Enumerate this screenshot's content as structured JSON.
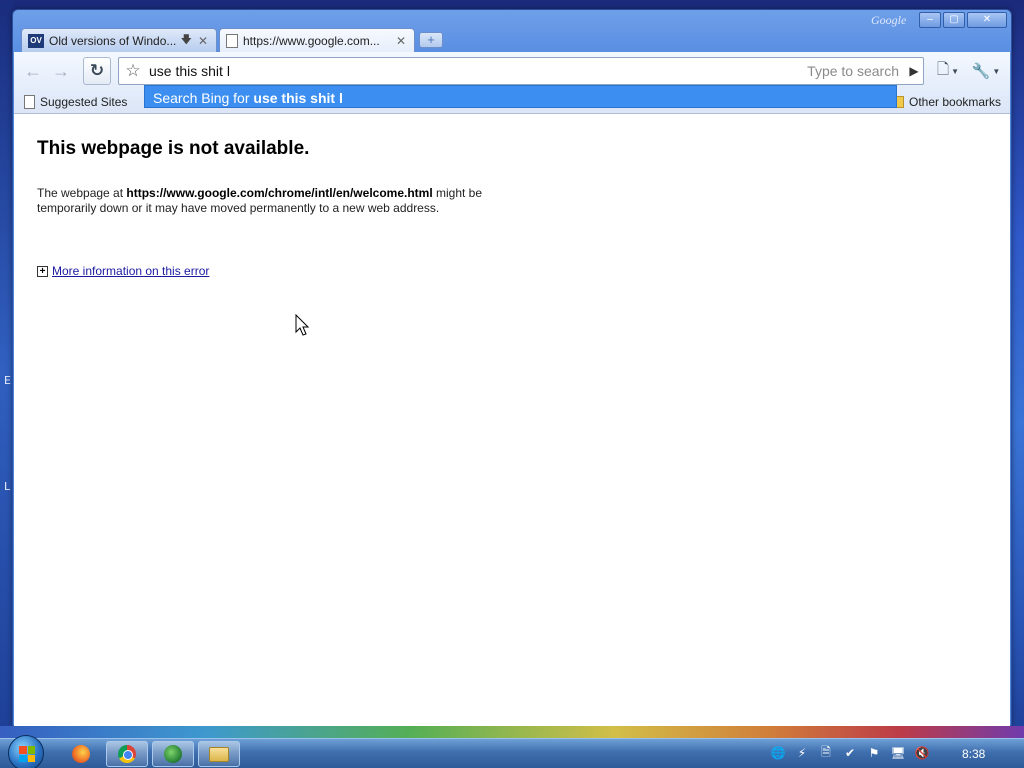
{
  "desktop": {
    "edge_letters": [
      "E",
      "L"
    ]
  },
  "window": {
    "brand": "Google",
    "controls": {
      "minimize": "–",
      "maximize": "▢",
      "close": "✕"
    }
  },
  "tabs": [
    {
      "title": "Old versions of Windo...",
      "favicon": "OV",
      "active": false
    },
    {
      "title": "https://www.google.com...",
      "active": true
    }
  ],
  "newtab_label": "+",
  "toolbar": {
    "back_icon": "←",
    "forward_icon": "→",
    "reload_icon": "↻",
    "omnibox_value": "use this shit l",
    "search_hint": "Type to search",
    "go_icon": "▶",
    "page_menu_icon": "🗋",
    "wrench_icon": "🔧"
  },
  "bookmarks": {
    "left_item": "Suggested Sites",
    "right_item": "Other bookmarks"
  },
  "suggestion": {
    "prefix": "Search Bing for ",
    "query": "use this shit l"
  },
  "error_page": {
    "title": "This webpage is not available.",
    "body_prefix": "The webpage at ",
    "url": "https://www.google.com/chrome/intl/en/welcome.html",
    "body_suffix": " might be temporarily down or it may have moved permanently to a new web address.",
    "more_info": "More information on this error"
  },
  "taskbar": {
    "clock": "8:38"
  },
  "colors": {
    "suggest_bg": "#3c8ff0",
    "link": "#1a1aa0"
  }
}
